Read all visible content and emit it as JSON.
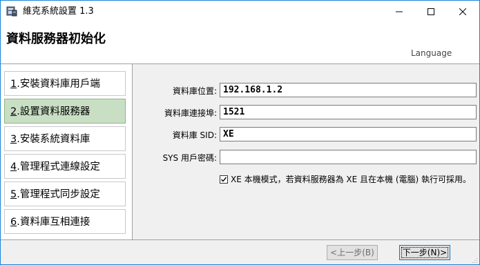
{
  "window": {
    "title": "維克系統設置 1.3"
  },
  "header": {
    "page_title": "資料服務器初始化",
    "language_link": "Language"
  },
  "steps": [
    {
      "num": "1",
      "label": ".安裝資料庫用戶端",
      "active": false
    },
    {
      "num": "2",
      "label": ".設置資料服務器",
      "active": true
    },
    {
      "num": "3",
      "label": ".安裝系統資料庫",
      "active": false
    },
    {
      "num": "4",
      "label": ".管理程式連線設定",
      "active": false
    },
    {
      "num": "5",
      "label": ".管理程式同步設定",
      "active": false
    },
    {
      "num": "6",
      "label": ".資料庫互相連接",
      "active": false
    }
  ],
  "form": {
    "db_location_label": "資料庫位置:",
    "db_location_value": "192.168.1.2",
    "db_port_label": "資料庫連接埠:",
    "db_port_value": "1521",
    "db_sid_label": "資料庫 SID:",
    "db_sid_value": "XE",
    "sys_password_label": "SYS 用戶密碼:",
    "sys_password_value": "",
    "xe_checkbox_label": "XE 本機模式，若資料服務器為 XE 且在本機 (電腦) 執行可採用。",
    "xe_checkbox_checked": true
  },
  "footer": {
    "back_label": "<上一步(B)",
    "next_label": "下一步(N)>"
  },
  "icons": {
    "app": "app-icon",
    "minimize": "minimize-icon",
    "maximize": "maximize-icon",
    "close": "close-icon",
    "check": "checkmark-icon",
    "grip": "resize-grip-icon"
  }
}
